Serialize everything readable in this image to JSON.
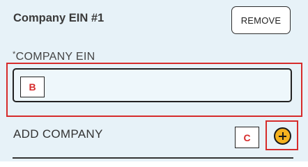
{
  "company_section": {
    "title": "Company EIN #1",
    "remove_label": "REMOVE",
    "field": {
      "required_mark": "*",
      "label": "COMPANY EIN",
      "value": "",
      "placeholder": ""
    }
  },
  "add_company": {
    "label": "ADD COMPANY",
    "button_icon": "plus-circle-icon"
  },
  "annotations": {
    "b": "B",
    "c": "C"
  },
  "colors": {
    "panel_bg": "#e7f2f8",
    "annotation_red": "#d62b2b",
    "add_button_yellow": "#f5b21f"
  }
}
